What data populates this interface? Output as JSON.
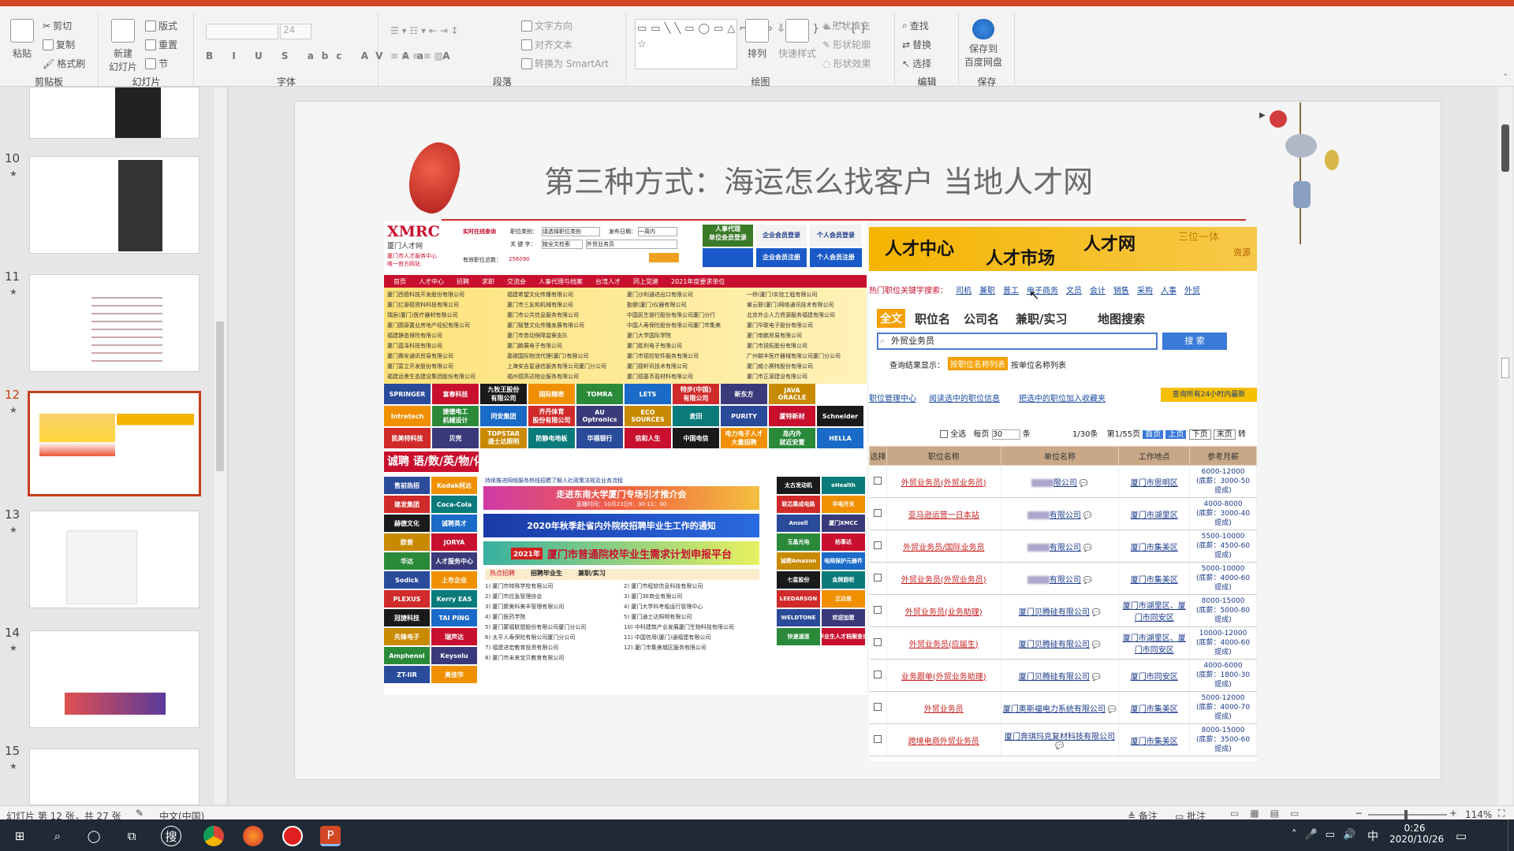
{
  "ribbon": {
    "groups": [
      {
        "label": "剪贴板"
      },
      {
        "label": "幻灯片"
      },
      {
        "label": "字体"
      },
      {
        "label": "段落"
      },
      {
        "label": "绘图"
      },
      {
        "label": "编辑"
      },
      {
        "label": "保存"
      }
    ],
    "clipboard": {
      "paste": "粘贴",
      "cut": "剪切",
      "copy": "复制",
      "format_painter": "格式刷"
    },
    "slides": {
      "new_slide": "新建\n幻灯片",
      "layout": "版式",
      "reset": "重置",
      "section": "节"
    },
    "font": {
      "font_name": "",
      "font_size": "24"
    },
    "paragraph": {
      "text_direction": "文字方向",
      "align_text": "对齐文本",
      "smartart": "转换为 SmartArt"
    },
    "drawing": {
      "arrange": "排列",
      "quick_styles": "快速样式",
      "shape_fill": "形状填充",
      "shape_outline": "形状轮廓",
      "shape_effects": "形状效果"
    },
    "editing": {
      "find": "查找",
      "replace": "替换",
      "select": "选择"
    },
    "save": {
      "save_to_baidu": "保存到\n百度网盘"
    }
  },
  "thumbnails": [
    {
      "num": "10",
      "star": "★"
    },
    {
      "num": "11",
      "star": "★"
    },
    {
      "num": "12",
      "star": "★"
    },
    {
      "num": "13",
      "star": "★"
    },
    {
      "num": "14",
      "star": "★"
    },
    {
      "num": "15",
      "star": "★"
    }
  ],
  "slide": {
    "title": "第三种方式：海运怎么找客户  当地人才网"
  },
  "site1": {
    "logo": "XMRC",
    "logo_sub": "厦门人才网",
    "tagline": "厦门市人才服务中心\n唯一官方网站",
    "search_label": "实时在线查询",
    "job_cat_label": "职位类别：",
    "job_cat_value": "请选择职位类别",
    "date_label": "发布日期：",
    "date_value": "一周内",
    "keyword_label": "关 键 字：",
    "keyword_scope": "按全文检索",
    "keyword_value": "外贸业务员",
    "count_label": "有效职位总数：",
    "count_value": "256090",
    "btn_agency": "人事代理\n单位会员登录",
    "btn_company_login": "企业会员登录",
    "btn_personal_login": "个人会员登录",
    "btn_company_reg": "企业会员注册",
    "btn_personal_reg": "个人会员注册",
    "nav": [
      "首页",
      "人才中心",
      "招聘",
      "求职",
      "交流会",
      "人事代理与档案",
      "台湾人才",
      "同上党建",
      "2021年度要求单位"
    ],
    "companies_col1": [
      "厦门西德科技开发股份有限公司",
      "厦门亿源德资料科技有限公司",
      "瑞辰(厦门)医疗器材有限公司",
      "厦门圆源置业房地产经纪有限公司",
      "福建静态保险有限公司",
      "厦门蓝泽科技有限公司",
      "厦门赛安通讯贸易有限公司",
      "厦门富立开发股份有限公司",
      "福建远景生态建设集团股份有限公司"
    ],
    "companies_col2": [
      "福建希望文化传播有限公司",
      "厦门市三友和机械有限公司",
      "厦门市公共信息服务有限公司",
      "厦门智慧文化传播发展有限公司",
      "厦门市劳动保障监察支队",
      "厦门鹏展电子有限公司",
      "嘉碳国际物流代理(厦门)有限公司",
      "上海安吉星通信服务有限公司厦门分公司",
      "福州德高达物业服务有限公司"
    ],
    "companies_col3": [
      "厦门沙利通进出口有限公司",
      "勤健(厦门)仪器有限公司",
      "中国民生银行股份有限公司厦门分行",
      "中国人寿保险股份有限公司厦门市集美",
      "厦门大学国际学院",
      "厦门胜利电子有限公司",
      "厦门市德控软件服务有限公司",
      "厦门德轩讯技术有限公司",
      "厦门德基币盈材料有限公司"
    ],
    "companies_col4": [
      "一桥(厦门)实验工程有限公司",
      "睿云联(厦门)网络通讯技术有限公司",
      "北京外企人力资源服务福建有限公司",
      "厦门华联电子股份有限公司",
      "厦门帝鹏贸易有限公司",
      "厦门市锐拓股份有限公司",
      "广州朝丰医疗器械有限公司厦门分公司",
      "厦门威小赛特股份有限公司",
      "厦门市正源建设有限公司"
    ],
    "logos_row1": [
      "SPRINGER",
      "富春科技",
      "九牧王股份\n有限公司",
      "国际精密",
      "TOMRA",
      "LETS",
      "特步(中国)\n有限公司",
      "新东方",
      "JAVA\nORACLE"
    ],
    "logos_row2": [
      "Intretech",
      "捷德电工\n机械设计",
      "同安集团",
      "齐丹体育\n股份有限公司",
      "AU\nOptronics",
      "ECO\nSOURCES",
      "麦田",
      "PURITY",
      "厦特新材",
      "Schneider"
    ],
    "logos_row3": [
      "凯美特科技",
      "贝壳",
      "TOPSTAR\n通士达照明",
      "防静电地板",
      "华福银行",
      "信和人生",
      "中国电信",
      "电力电子人才\n大量招聘",
      "岛内外\n就近安置",
      "HELLA"
    ],
    "recruit_banner": "诚聘 语/数/英/物/化/教师",
    "left_logos": [
      "售前热招",
      "Kodak柯达",
      "建发集团",
      "Coca-Cola",
      "赫德文化",
      "诚聘英才",
      "欧普",
      "JORYA",
      "华达",
      "人才服务中心",
      "Sodick",
      "上市企业",
      "PLEXUS",
      "Kerry EAS",
      "冠捷科技",
      "TAI PING",
      "先锋电子",
      "瑞声达",
      "Amphenol",
      "Keysolu",
      "ZT-IIR",
      "奥佳华"
    ],
    "notice": "持续推进网络服务热线招聘了解人社政策法规及业务流程",
    "banner1": "走进东南大学厦门专场引才推介会",
    "banner1_date": "直播时间：10月23日9：30-11：00",
    "banner2": "2020年秋季赴省内外院校招聘毕业生工作的通知",
    "banner3": "厦门市普通院校毕业生需求计划申报平台",
    "banner3_year": "2021年",
    "tabs": [
      "热点招聘",
      "招聘毕业生",
      "兼职/实习"
    ],
    "news_col1": [
      "1) 厦门市特殊学校有限公司",
      "2) 厦门市应急管理协会",
      "3) 厦门聚美科美丰管理有限公司",
      "4) 厦门医药学院",
      "5) 厦门蒙福联盟股份有限公司厦门分公司",
      "6) 太平人寿保险有限公司厦门分公司",
      "7) 福建进宏教育投资有限公司",
      "8) 厦门市未来宝贝教育有限公司"
    ],
    "news_col2": [
      "2) 厦门市程软信息科技有限公司",
      "3) 厦门3E商业有限公司",
      "4) 厦门大学科考船运行管理中心",
      "5) 厦门通士达照明有限公司",
      "10) 中科建筑产业发展厦门生物科技有限公司",
      "11) 中国信用(厦门)通福建有限公司",
      "12) 厦门市集美城区服务有限公司"
    ],
    "right_logos": [
      "太古发动机",
      "eHealth",
      "联芯集成电路",
      "华电开关",
      "Ansell",
      "厦门XMCC",
      "玉晶光电",
      "柏事达",
      "诚聘Amazon",
      "电网保护元器件",
      "七星股份",
      "金牌厨柜",
      "LEEDARSON",
      "立达信",
      "WELDTONE",
      "欢迎加盟",
      "快速通道",
      "毕业生人才档案查询"
    ]
  },
  "site2": {
    "head1": "人才中心",
    "head2": "人才市场",
    "head3": "人才网",
    "head4": "三位一体",
    "head5": "资源",
    "kw_label": "热门职位关键字搜索：",
    "keywords": [
      "司机",
      "兼职",
      "普工",
      "电子商务",
      "文员",
      "会计",
      "销售",
      "采购",
      "人事",
      "外贸"
    ],
    "tabs": [
      "全文",
      "职位名",
      "公司名",
      "兼职/实习",
      "地图搜索"
    ],
    "search_value": "外贸业务员",
    "search_btn": "搜  索",
    "result_label": "查询结果显示：",
    "result_opt1": "按职位名称列表",
    "result_opt2": "按单位名称列表",
    "mgmt_link1": "职位管理中心",
    "mgmt_link2": "阅读选中的职位信息",
    "mgmt_link3": "把选中的职位加入收藏夹",
    "notice_btn": "查询所有24小时内最新",
    "select_all": "全选",
    "per_page_label": "每页",
    "per_page_value": "30",
    "per_page_suffix": "条",
    "record_count": "1/30条",
    "page_info": "第1/55页",
    "pager": [
      "首页",
      "上页",
      "下页",
      "末页",
      "转"
    ],
    "columns": [
      "选择",
      "职位名称",
      "单位名称",
      "工作地点",
      "参考月薪"
    ],
    "rows": [
      {
        "job": "外贸业务员(外贸业务员)",
        "company": "限公司",
        "location": "厦门市思明区",
        "salary": "6000-12000\n(底薪：3000-50\n提成)"
      },
      {
        "job": "亚马逊运营一日本站",
        "company": "有限公司",
        "location": "厦门市湖里区",
        "salary": "4000-8000\n(底薪：3000-40\n提成)"
      },
      {
        "job": "外贸业务员/国际业务员",
        "company": "有限公司",
        "location": "厦门市集美区",
        "salary": "5500-10000\n(底薪：4500-60\n提成)"
      },
      {
        "job": "外贸业务员(外贸业务员)",
        "company": "有限公司",
        "location": "厦门市集美区",
        "salary": "5000-10000\n(底薪：4000-60\n提成)"
      },
      {
        "job": "外贸业务员(业务助理)",
        "company": "厦门贝腾硅有限公司",
        "location": "厦门市湖里区、厦门市同安区",
        "salary": "8000-15000\n(底薪：5000-80\n提成)"
      },
      {
        "job": "外贸业务员(应届生)",
        "company": "厦门贝腾硅有限公司",
        "location": "厦门市湖里区、厦门市同安区",
        "salary": "10000-12000\n(底薪：4000-60\n提成)"
      },
      {
        "job": "业务跟单(外贸业务助理)",
        "company": "厦门贝腾硅有限公司",
        "location": "厦门市同安区",
        "salary": "4000-6000\n(底薪：1800-30\n提成)"
      },
      {
        "job": "外贸业务员",
        "company": "厦门奥斯福电力系统有限公司",
        "location": "厦门市集美区",
        "salary": "5000-12000\n(底薪：4000-70\n提成)"
      },
      {
        "job": "跨境电商外贸业务员",
        "company": "厦门奔琪玛克复材科技有限公司",
        "location": "厦门市集美区",
        "salary": "8000-15000\n(底薪：3500-60\n提成)"
      }
    ]
  },
  "statusbar": {
    "slide_info": "幻灯片 第 12 张，共 27 张",
    "language": "中文(中国)",
    "notes": "备注",
    "comments": "批注",
    "zoom": "114%"
  },
  "taskbar": {
    "time": "0:26",
    "date": "2020/10/26",
    "ime": "中"
  }
}
